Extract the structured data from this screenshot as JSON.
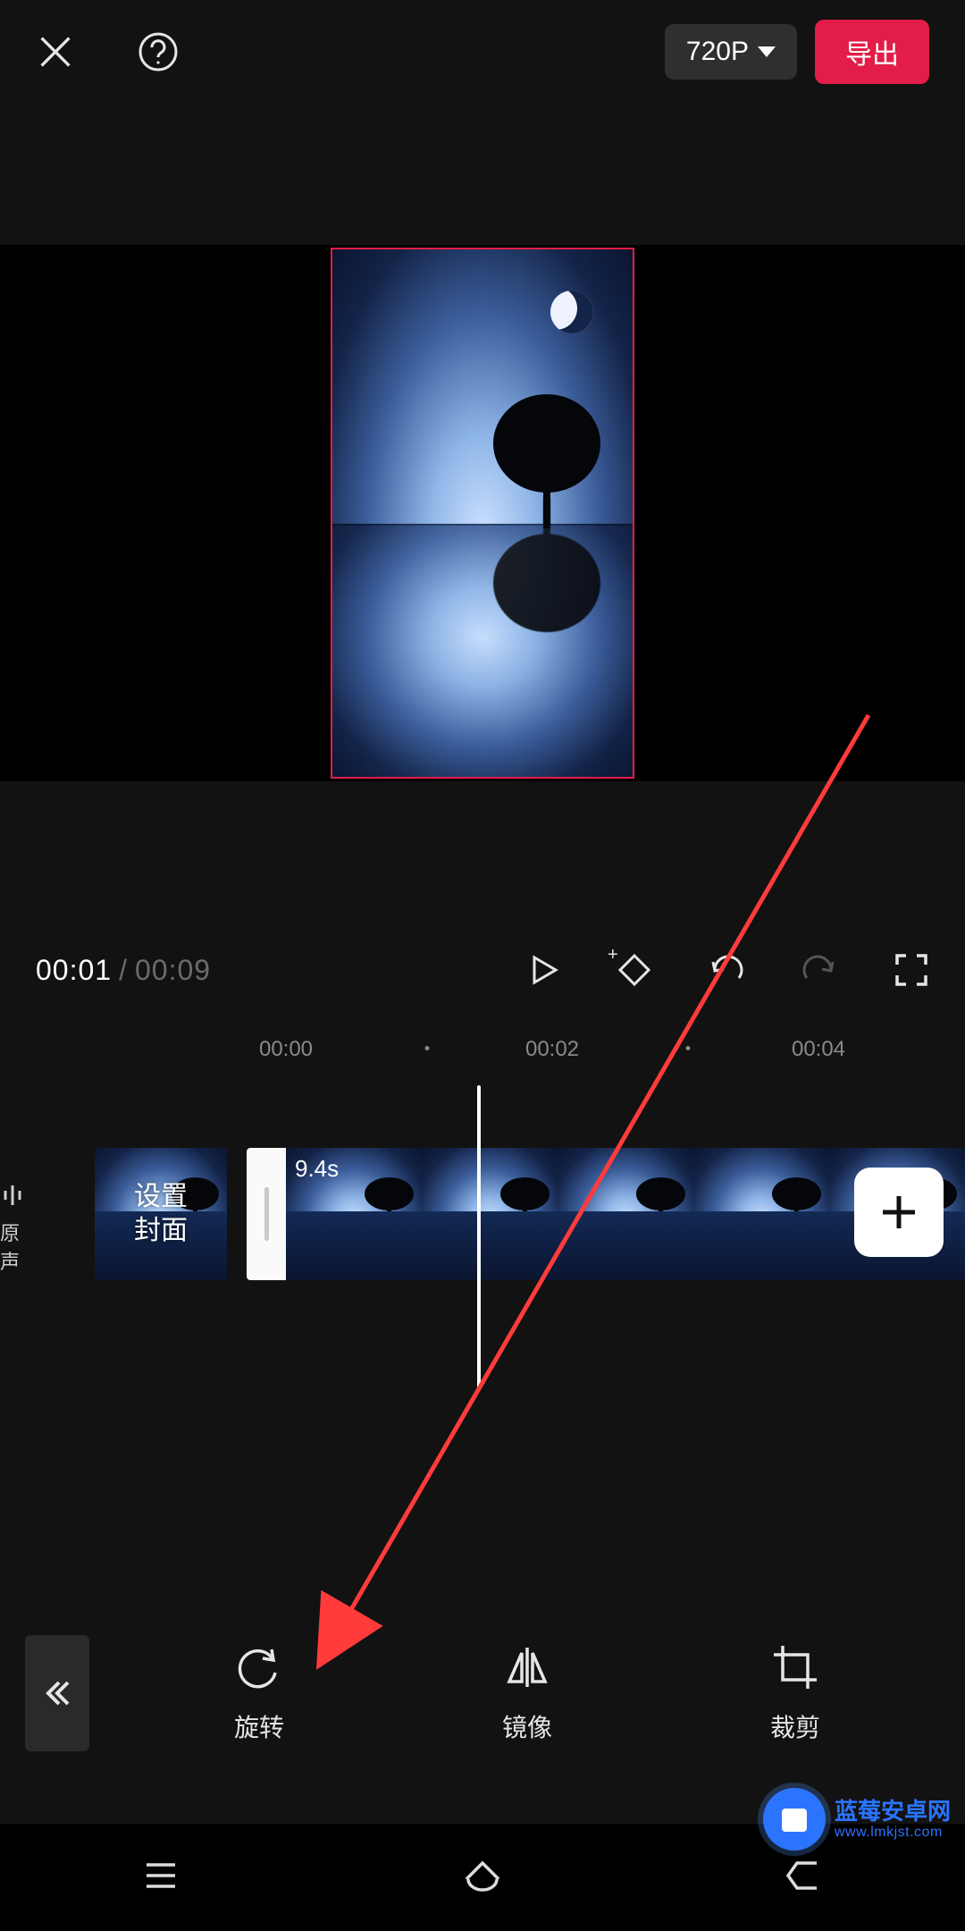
{
  "topbar": {
    "resolution_label": "720P",
    "export_label": "导出"
  },
  "transport": {
    "current_time": "00:01",
    "duration": "00:09"
  },
  "ruler": {
    "ticks": [
      "00:00",
      "00:02",
      "00:04"
    ]
  },
  "timeline": {
    "audio_label": "原声",
    "cover_label_line1": "设置",
    "cover_label_line2": "封面",
    "clip_duration_label": "9.4s"
  },
  "tools": {
    "rotate": "旋转",
    "mirror": "镜像",
    "crop": "裁剪"
  },
  "watermark": {
    "title": "蓝莓安卓网",
    "url": "www.lmkjst.com"
  }
}
